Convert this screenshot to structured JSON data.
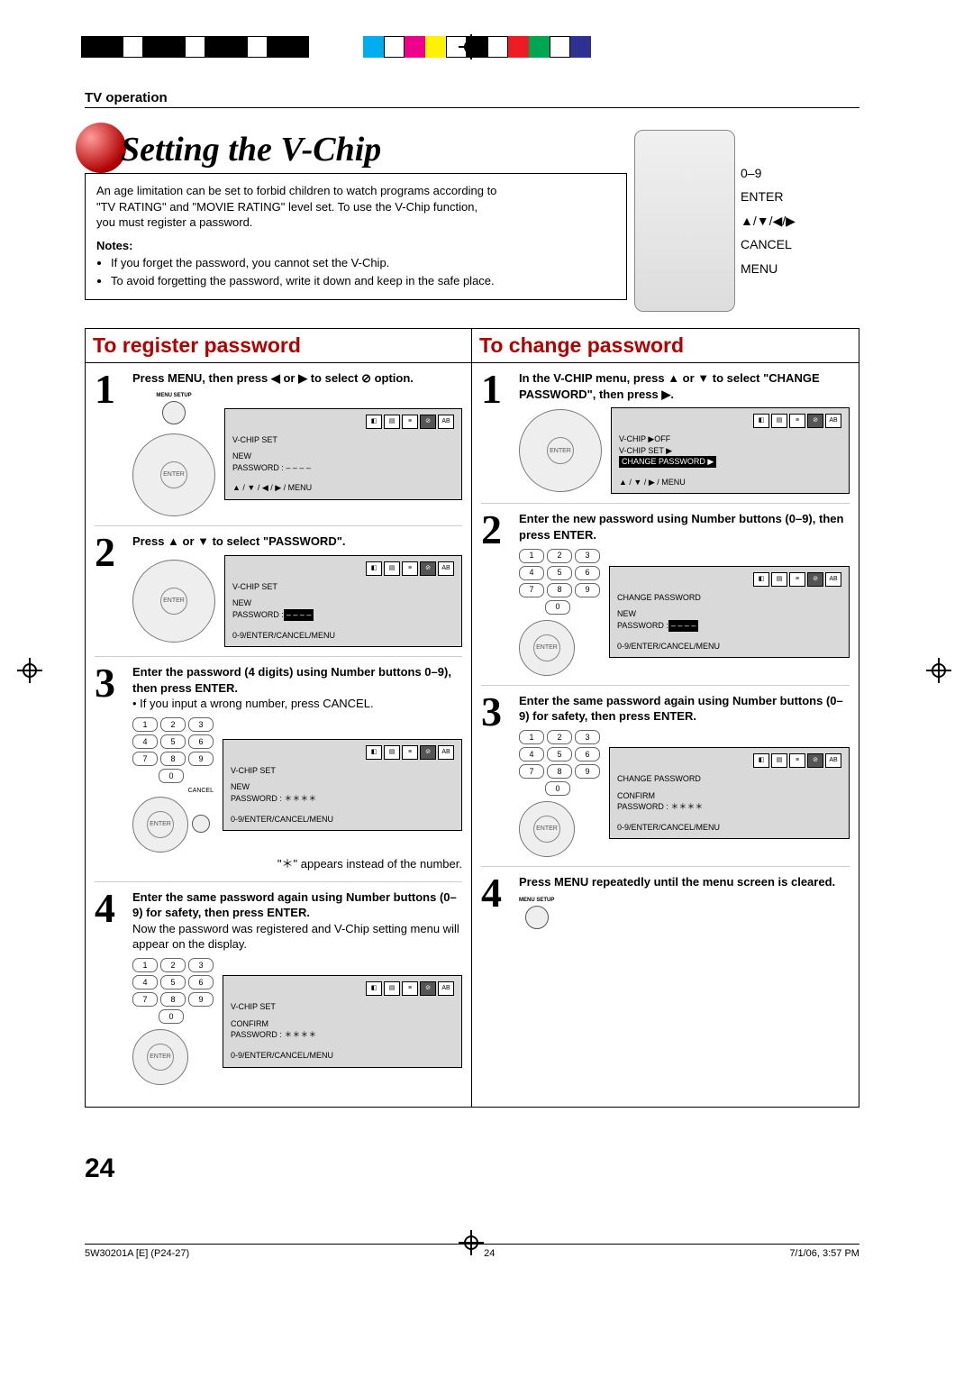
{
  "header": "TV operation",
  "title": "Setting the V-Chip",
  "intro": {
    "body_l1": "An age limitation can be set to forbid children to watch programs according to",
    "body_l2": "\"TV RATING\" and \"MOVIE RATING\" level set. To use the V-Chip function,",
    "body_l3": "you must register a password.",
    "notes_heading": "Notes:",
    "note1": "If you forget the password, you cannot set the V-Chip.",
    "note2": "To avoid forgetting the password, write it down and keep in the safe place."
  },
  "remote_labels": {
    "nums": "0–9",
    "enter": "ENTER",
    "arrows": "▲/▼/◀/▶",
    "cancel": "CANCEL",
    "menu": "MENU"
  },
  "left": {
    "heading": "To register password",
    "step1": "Press MENU, then press ◀ or ▶ to select ⊘ option.",
    "menu_btn": "MENU SETUP",
    "panel1": {
      "line1": "V-CHIP  SET",
      "line2a": "NEW",
      "line2b": "PASSWORD     : – – – –",
      "hint": "▲ / ▼ / ◀ / ▶ / MENU"
    },
    "step2": "Press ▲ or ▼ to select \"PASSWORD\".",
    "panel2": {
      "line1": "V-CHIP  SET",
      "line2a": "NEW",
      "line2b_pre": "PASSWORD     :",
      "line2b_hl": "– – – –",
      "hint": "0-9/ENTER/CANCEL/MENU"
    },
    "step3_bold": "Enter the password (4 digits) using Number buttons 0–9), then press ENTER.",
    "step3_sub": "• If you input a wrong number, press CANCEL.",
    "cancel_label": "CANCEL",
    "panel3": {
      "line1": "V-CHIP  SET",
      "line2a": "NEW",
      "line2b": "PASSWORD     : ＊＊＊＊",
      "hint": "0-9/ENTER/CANCEL/MENU"
    },
    "step3_note": "\"＊\" appears instead of the number.",
    "step4_bold": "Enter the same password again using Number buttons (0–9) for safety, then press ENTER.",
    "step4_sub": "Now the password was registered and V-Chip setting menu will appear on the display.",
    "panel4": {
      "line1": "V-CHIP  SET",
      "line2a": "CONFIRM",
      "line2b": "PASSWORD     : ＊＊＊＊",
      "hint": "0-9/ENTER/CANCEL/MENU"
    }
  },
  "right": {
    "heading": "To change password",
    "step1": "In the V-CHIP menu, press ▲ or ▼ to select \"CHANGE PASSWORD\", then press ▶.",
    "panel1": {
      "line1": "V-CHIP                         ▶OFF",
      "line2": "V-CHIP SET                   ▶",
      "line3_hl": "CHANGE PASSWORD          ▶",
      "hint": "▲ / ▼ / ▶ / MENU"
    },
    "step2": "Enter the new password using Number buttons (0–9), then press ENTER.",
    "panel2": {
      "line1": "CHANGE  PASSWORD",
      "line2a": "NEW",
      "line2b_pre": "PASSWORD     :",
      "line2b_hl": "– – – –",
      "hint": "0-9/ENTER/CANCEL/MENU"
    },
    "step3": "Enter the same password again using Number buttons (0–9) for safety, then press ENTER.",
    "panel3": {
      "line1": "CHANGE  PASSWORD",
      "line2a": "CONFIRM",
      "line2b": "PASSWORD     : ＊＊＊＊",
      "hint": "0-9/ENTER/CANCEL/MENU"
    },
    "step4": "Press MENU repeatedly until the menu screen is cleared.",
    "menu_btn": "MENU SETUP"
  },
  "page_number": "24",
  "footer": {
    "left": "5W30201A [E] (P24-27)",
    "center": "24",
    "right": "7/1/06, 3:57 PM"
  },
  "keypad": [
    "1",
    "2",
    "3",
    "4",
    "5",
    "6",
    "7",
    "8",
    "9",
    "0"
  ]
}
